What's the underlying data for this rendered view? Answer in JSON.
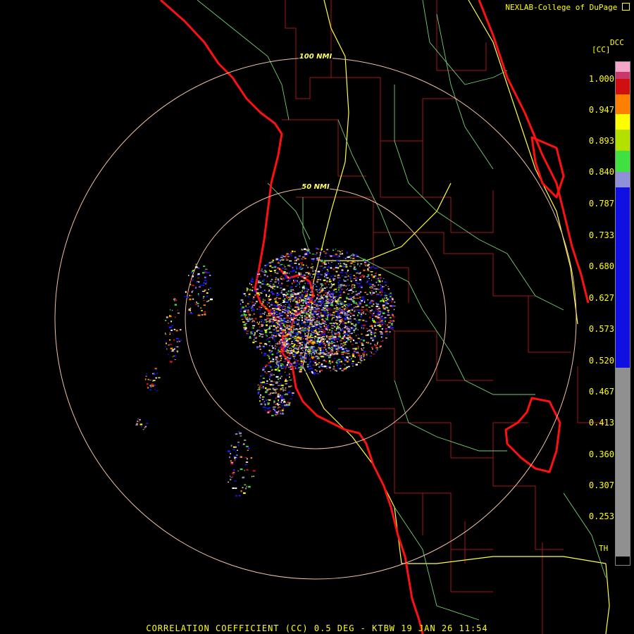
{
  "credit": "NEXLAB-College of DuPage",
  "logo_icon": "cod-logo-icon",
  "caption": "CORRELATION COEFFICIENT (CC) 0.5 DEG - KTBW 19 JAN 26 11:54",
  "range_rings": [
    {
      "label": "100 NMI"
    },
    {
      "label": "50 NMI"
    }
  ],
  "colorbar": {
    "product": "DCC",
    "unit": "[CC]",
    "labels": [
      "1.000",
      "0.947",
      "0.893",
      "0.840",
      "0.787",
      "0.733",
      "0.680",
      "0.627",
      "0.573",
      "0.520",
      "0.467",
      "0.413",
      "0.360",
      "0.307",
      "0.253"
    ],
    "threshold_label": "TH",
    "colors": {
      "pink": "#f4a6c8",
      "magenta": "#c8386a",
      "red": "#d01010",
      "orange": "#ff8000",
      "yellow": "#ffff00",
      "yellowgreen": "#b4e000",
      "green": "#40e040",
      "lavender": "#9090d8",
      "blue": "#1010e0",
      "gray": "#909090"
    }
  },
  "colors": {
    "background": "#000000",
    "coastline": "#ff1010",
    "county_lines": "#b02020",
    "highways_primary": "#ffff40",
    "highways_secondary": "#80e080",
    "range_rings": "#f0c0a0"
  }
}
